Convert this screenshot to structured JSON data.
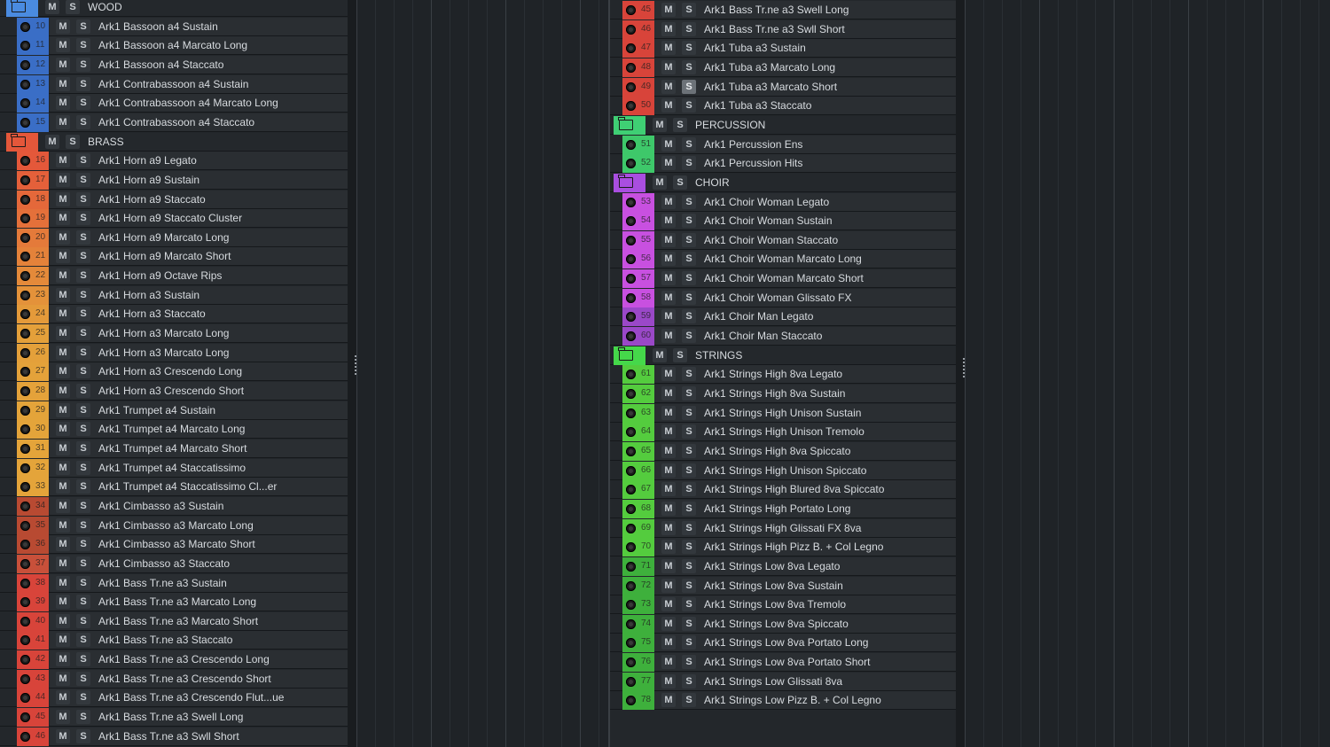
{
  "button_labels": {
    "mute": "M",
    "solo": "S"
  },
  "icons": {
    "folder": "folder-open-icon",
    "record": "record-arm-icon"
  },
  "colors": {
    "wood": "#3c6ec4",
    "brass_header": "#e45a3a",
    "percussion": "#3fcf74",
    "choir": "#b84ee0",
    "strings": "#45c84a",
    "solo_active": "#6c7278"
  },
  "left_panel": {
    "rows": [
      {
        "type": "folder",
        "name": "WOOD",
        "color": "#4a8be0"
      },
      {
        "type": "track",
        "number": "10",
        "name": "Ark1 Bassoon a4 Sustain",
        "color": "#3a6ec6"
      },
      {
        "type": "track",
        "number": "11",
        "name": "Ark1 Bassoon a4 Marcato Long",
        "color": "#3a6ec6"
      },
      {
        "type": "track",
        "number": "12",
        "name": "Ark1 Bassoon a4 Staccato",
        "color": "#3a6ec6"
      },
      {
        "type": "track",
        "number": "13",
        "name": "Ark1 Contrabassoon a4 Sustain",
        "color": "#3a6ec6"
      },
      {
        "type": "track",
        "number": "14",
        "name": "Ark1 Contrabassoon a4 Marcato Long",
        "color": "#3a6ec6"
      },
      {
        "type": "track",
        "number": "15",
        "name": "Ark1 Contrabassoon a4 Staccato",
        "color": "#3a6ec6"
      },
      {
        "type": "folder",
        "name": "BRASS",
        "color": "#e4573a"
      },
      {
        "type": "track",
        "number": "16",
        "name": "Ark1 Horn a9 Legato",
        "color": "#e4583a"
      },
      {
        "type": "track",
        "number": "17",
        "name": "Ark1 Horn a9 Sustain",
        "color": "#e4603a"
      },
      {
        "type": "track",
        "number": "18",
        "name": "Ark1 Horn a9 Staccato",
        "color": "#e4683a"
      },
      {
        "type": "track",
        "number": "19",
        "name": "Ark1 Horn a9 Staccato Cluster",
        "color": "#e4703a"
      },
      {
        "type": "track",
        "number": "20",
        "name": "Ark1 Horn a9 Marcato Long",
        "color": "#e47a3a"
      },
      {
        "type": "track",
        "number": "21",
        "name": "Ark1 Horn a9 Marcato Short",
        "color": "#e4823a"
      },
      {
        "type": "track",
        "number": "22",
        "name": "Ark1 Horn a9 Octave Rips",
        "color": "#e48a3a"
      },
      {
        "type": "track",
        "number": "23",
        "name": "Ark1 Horn a3 Sustain",
        "color": "#e4923a"
      },
      {
        "type": "track",
        "number": "24",
        "name": "Ark1 Horn a3 Staccato",
        "color": "#e49a3a"
      },
      {
        "type": "track",
        "number": "25",
        "name": "Ark1 Horn a3 Marcato Long",
        "color": "#e4a03a"
      },
      {
        "type": "track",
        "number": "26",
        "name": "Ark1 Horn a3 Marcato Long",
        "color": "#e4a03a"
      },
      {
        "type": "track",
        "number": "27",
        "name": "Ark1 Horn a3 Crescendo Long",
        "color": "#e4a23a"
      },
      {
        "type": "track",
        "number": "28",
        "name": "Ark1 Horn a3 Crescendo Short",
        "color": "#e4a23a"
      },
      {
        "type": "track",
        "number": "29",
        "name": "Ark1 Trumpet a4 Sustain",
        "color": "#e4a43a"
      },
      {
        "type": "track",
        "number": "30",
        "name": "Ark1 Trumpet a4 Marcato Long",
        "color": "#e4a43a"
      },
      {
        "type": "track",
        "number": "31",
        "name": "Ark1 Trumpet a4 Marcato Short",
        "color": "#e4a43a"
      },
      {
        "type": "track",
        "number": "32",
        "name": "Ark1 Trumpet a4 Staccatissimo",
        "color": "#e4a43a"
      },
      {
        "type": "track",
        "number": "33",
        "name": "Ark1 Trumpet a4 Staccatissimo Cl...er",
        "color": "#e4a43a"
      },
      {
        "type": "track",
        "number": "34",
        "name": "Ark1 Cimbasso a3 Sustain",
        "color": "#b84a32"
      },
      {
        "type": "track",
        "number": "35",
        "name": "Ark1 Cimbasso a3 Marcato Long",
        "color": "#b84a32"
      },
      {
        "type": "track",
        "number": "36",
        "name": "Ark1 Cimbasso a3 Marcato Short",
        "color": "#b84a32"
      },
      {
        "type": "track",
        "number": "37",
        "name": "Ark1 Cimbasso a3 Staccato",
        "color": "#c8503a"
      },
      {
        "type": "track",
        "number": "38",
        "name": "Ark1 Bass Tr.ne a3 Sustain",
        "color": "#d8443a"
      },
      {
        "type": "track",
        "number": "39",
        "name": "Ark1 Bass Tr.ne a3 Marcato Long",
        "color": "#d8443a"
      },
      {
        "type": "track",
        "number": "40",
        "name": "Ark1 Bass Tr.ne a3 Marcato Short",
        "color": "#d8443a"
      },
      {
        "type": "track",
        "number": "41",
        "name": "Ark1 Bass Tr.ne a3 Staccato",
        "color": "#d8443a"
      },
      {
        "type": "track",
        "number": "42",
        "name": "Ark1 Bass Tr.ne a3 Crescendo Long",
        "color": "#d8443a"
      },
      {
        "type": "track",
        "number": "43",
        "name": "Ark1 Bass Tr.ne a3 Crescendo Short",
        "color": "#d8443a"
      },
      {
        "type": "track",
        "number": "44",
        "name": "Ark1 Bass Tr.ne a3 Crescendo Flut...ue",
        "color": "#d8443a"
      },
      {
        "type": "track",
        "number": "45",
        "name": "Ark1 Bass Tr.ne a3 Swell Long",
        "color": "#d8443a"
      },
      {
        "type": "track",
        "number": "46",
        "name": "Ark1 Bass Tr.ne a3 Swll Short",
        "color": "#d8443a"
      }
    ]
  },
  "right_panel": {
    "rows": [
      {
        "type": "track",
        "number": "45",
        "name": "Ark1 Bass Tr.ne a3 Swell Long",
        "color": "#d8443a"
      },
      {
        "type": "track",
        "number": "46",
        "name": "Ark1 Bass Tr.ne a3 Swll Short",
        "color": "#d8443a"
      },
      {
        "type": "track",
        "number": "47",
        "name": "Ark1 Tuba a3 Sustain",
        "color": "#d8443a"
      },
      {
        "type": "track",
        "number": "48",
        "name": "Ark1 Tuba a3 Marcato Long",
        "color": "#d8443a"
      },
      {
        "type": "track",
        "number": "49",
        "name": "Ark1 Tuba a3 Marcato Short",
        "color": "#d8443a",
        "solo_active": true
      },
      {
        "type": "track",
        "number": "50",
        "name": "Ark1 Tuba a3 Staccato",
        "color": "#d8443a"
      },
      {
        "type": "folder",
        "name": "PERCUSSION",
        "color": "#3fcf74"
      },
      {
        "type": "track",
        "number": "51",
        "name": "Ark1 Percussion Ens",
        "color": "#3ec86a"
      },
      {
        "type": "track",
        "number": "52",
        "name": "Ark1 Percussion Hits",
        "color": "#3ec86a"
      },
      {
        "type": "folder",
        "name": "CHOIR",
        "color": "#a94ee0"
      },
      {
        "type": "track",
        "number": "53",
        "name": "Ark1 Choir Woman Legato",
        "color": "#c850e0"
      },
      {
        "type": "track",
        "number": "54",
        "name": "Ark1 Choir Woman Sustain",
        "color": "#c850e0"
      },
      {
        "type": "track",
        "number": "55",
        "name": "Ark1 Choir Woman Staccato",
        "color": "#c850e0"
      },
      {
        "type": "track",
        "number": "56",
        "name": "Ark1 Choir Woman Marcato Long",
        "color": "#c850e0"
      },
      {
        "type": "track",
        "number": "57",
        "name": "Ark1 Choir Woman Marcato Short",
        "color": "#c850e0"
      },
      {
        "type": "track",
        "number": "58",
        "name": "Ark1 Choir Woman Glissato FX",
        "color": "#c850e0"
      },
      {
        "type": "track",
        "number": "59",
        "name": "Ark1 Choir Man Legato",
        "color": "#9a48c8"
      },
      {
        "type": "track",
        "number": "60",
        "name": "Ark1 Choir Man Staccato",
        "color": "#9a48c8"
      },
      {
        "type": "folder",
        "name": "STRINGS",
        "color": "#45d84a"
      },
      {
        "type": "track",
        "number": "61",
        "name": "Ark1 Strings High 8va Legato",
        "color": "#54cc3e"
      },
      {
        "type": "track",
        "number": "62",
        "name": "Ark1 Strings High 8va Sustain",
        "color": "#54cc3e"
      },
      {
        "type": "track",
        "number": "63",
        "name": "Ark1 Strings High Unison Sustain",
        "color": "#54cc3e"
      },
      {
        "type": "track",
        "number": "64",
        "name": "Ark1 Strings High Unison Tremolo",
        "color": "#54cc3e"
      },
      {
        "type": "track",
        "number": "65",
        "name": "Ark1 Strings High 8va Spiccato",
        "color": "#54cc3e"
      },
      {
        "type": "track",
        "number": "66",
        "name": "Ark1 Strings High Unison Spiccato",
        "color": "#54cc3e"
      },
      {
        "type": "track",
        "number": "67",
        "name": "Ark1 Strings High Blured 8va Spiccato",
        "color": "#54cc3e"
      },
      {
        "type": "track",
        "number": "68",
        "name": "Ark1 Strings High Portato Long",
        "color": "#54cc3e"
      },
      {
        "type": "track",
        "number": "69",
        "name": "Ark1 Strings High Glissati FX 8va",
        "color": "#54cc3e"
      },
      {
        "type": "track",
        "number": "70",
        "name": "Ark1 Strings High Pizz B. + Col Legno",
        "color": "#54cc3e"
      },
      {
        "type": "track",
        "number": "71",
        "name": "Ark1 Strings Low 8va Legato",
        "color": "#3eb03c"
      },
      {
        "type": "track",
        "number": "72",
        "name": "Ark1 Strings Low 8va Sustain",
        "color": "#3eb03c"
      },
      {
        "type": "track",
        "number": "73",
        "name": "Ark1 Strings Low 8va Tremolo",
        "color": "#3eb03c"
      },
      {
        "type": "track",
        "number": "74",
        "name": "Ark1 Strings Low 8va Spiccato",
        "color": "#3eb03c"
      },
      {
        "type": "track",
        "number": "75",
        "name": "Ark1 Strings Low 8va Portato Long",
        "color": "#3eb03c"
      },
      {
        "type": "track",
        "number": "76",
        "name": "Ark1 Strings Low 8va Portato Short",
        "color": "#3eb03c"
      },
      {
        "type": "track",
        "number": "77",
        "name": "Ark1 Strings Low Glissati 8va",
        "color": "#3eb03c"
      },
      {
        "type": "track",
        "number": "78",
        "name": "Ark1 Strings Low Pizz B. + Col Legno",
        "color": "#3eb03c"
      }
    ]
  }
}
